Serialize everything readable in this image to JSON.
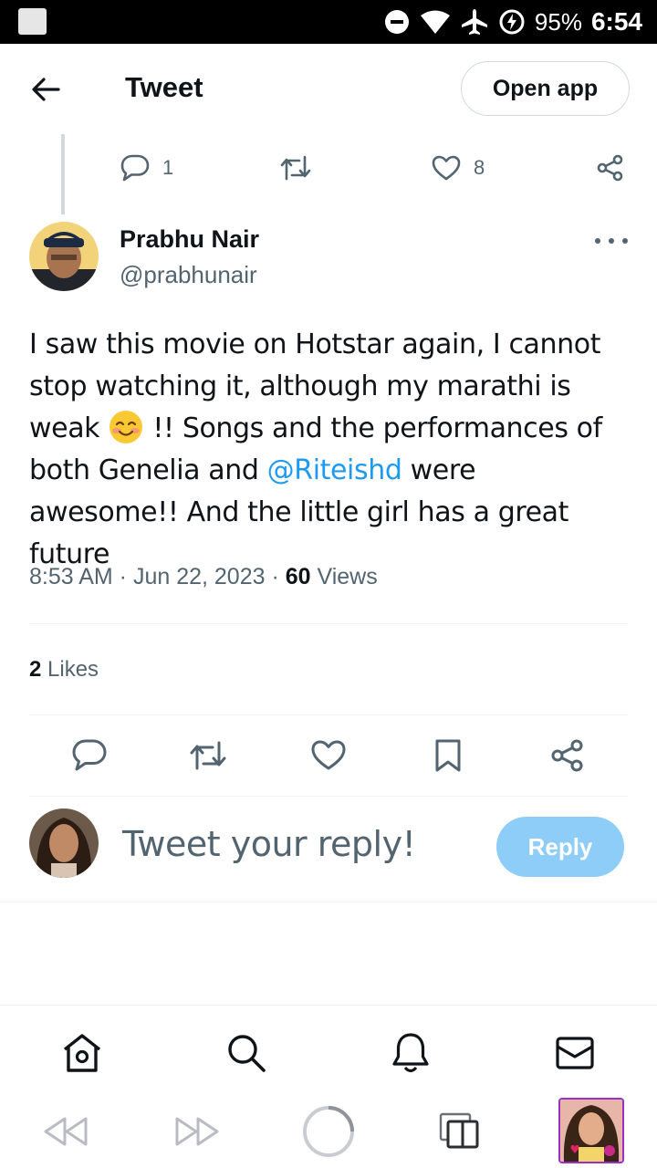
{
  "status_bar": {
    "battery": "95%",
    "time": "6:54"
  },
  "header": {
    "title": "Tweet",
    "open_app_label": "Open app"
  },
  "previous_tweet": {
    "reply_count": "1",
    "like_count": "8"
  },
  "tweet": {
    "author_name": "Prabhu Nair",
    "author_handle": "@prabhunair",
    "text_part1": "I saw this movie on Hotstar again, I cannot stop watching it, although my marathi is weak",
    "text_part2": " !! Songs and the performances of both Genelia and ",
    "mention": "@Riteishd",
    "text_part3": " were awesome!! And the little girl has a great future",
    "timestamp": "8:53 AM · Jun 22, 2023",
    "separator": " · ",
    "views_count": "60",
    "views_label": " Views",
    "likes_count": "2",
    "likes_label": " Likes"
  },
  "reply_box": {
    "placeholder": "Tweet your reply!",
    "reply_label": "Reply"
  },
  "colors": {
    "accent": "#1d9bf0",
    "reply_button_disabled": "#8ecdf8",
    "secondary_text": "#536471",
    "primary_text": "#0f1419",
    "divider": "#eff3f4"
  }
}
